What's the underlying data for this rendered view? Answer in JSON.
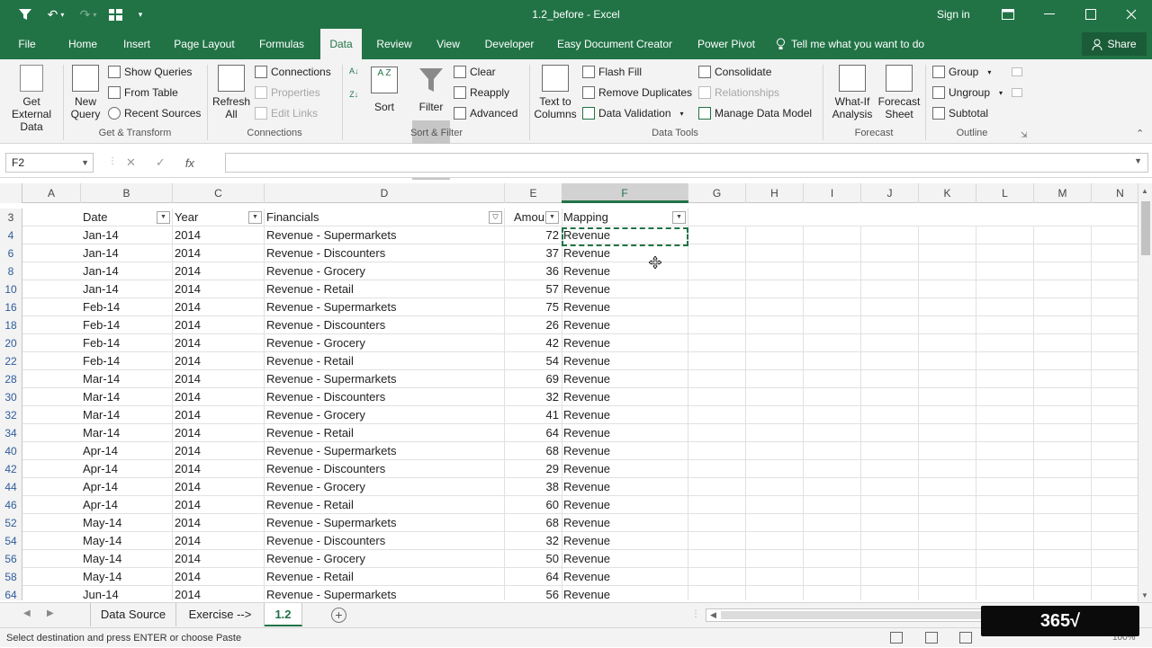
{
  "title_bar": {
    "document_title": "1.2_before  -  Excel",
    "sign_in": "Sign in",
    "accent": "#217346"
  },
  "tabs": [
    "File",
    "Home",
    "Insert",
    "Page Layout",
    "Formulas",
    "Data",
    "Review",
    "View",
    "Developer",
    "Easy Document Creator",
    "Power Pivot"
  ],
  "active_tab": "Data",
  "tell_me": "Tell me what you want to do",
  "share": "Share",
  "ribbon": {
    "get_external_data": [
      "Get External",
      "Data"
    ],
    "new_query": [
      "New",
      "Query"
    ],
    "show_queries": "Show Queries",
    "from_table": "From Table",
    "recent_sources": "Recent Sources",
    "get_transform": "Get & Transform",
    "refresh_all": [
      "Refresh",
      "All"
    ],
    "connections": "Connections",
    "properties": "Properties",
    "edit_links": "Edit Links",
    "connections_group": "Connections",
    "sort": "Sort",
    "filter": "Filter",
    "clear": "Clear",
    "reapply": "Reapply",
    "advanced": "Advanced",
    "sort_filter": "Sort & Filter",
    "text_to_columns": [
      "Text to",
      "Columns"
    ],
    "flash_fill": "Flash Fill",
    "remove_duplicates": "Remove Duplicates",
    "data_validation": "Data Validation",
    "consolidate": "Consolidate",
    "relationships": "Relationships",
    "manage_data_model": "Manage Data Model",
    "data_tools": "Data Tools",
    "what_if": [
      "What-If",
      "Analysis"
    ],
    "forecast_sheet": [
      "Forecast",
      "Sheet"
    ],
    "forecast": "Forecast",
    "group": "Group",
    "ungroup": "Ungroup",
    "subtotal": "Subtotal",
    "outline": "Outline",
    "sort_az": "A Z"
  },
  "formula_bar": {
    "name_box": "F2",
    "cancel": "✕",
    "enter": "✓",
    "fx": "fx",
    "formula": ""
  },
  "columns": [
    "A",
    "B",
    "C",
    "D",
    "E",
    "F",
    "G",
    "H",
    "I",
    "J",
    "K",
    "L",
    "M",
    "N"
  ],
  "header_row": {
    "row_num": "3",
    "date": "Date",
    "year": "Year",
    "financials": "Financials",
    "amount": "Amou",
    "mapping": "Mapping"
  },
  "rows": [
    {
      "num": "4",
      "date": "Jan-14",
      "year": "2014",
      "fin": "Revenue - Supermarkets",
      "amt": "72",
      "map": "Revenue"
    },
    {
      "num": "6",
      "date": "Jan-14",
      "year": "2014",
      "fin": "Revenue - Discounters",
      "amt": "37",
      "map": "Revenue"
    },
    {
      "num": "8",
      "date": "Jan-14",
      "year": "2014",
      "fin": "Revenue - Grocery",
      "amt": "36",
      "map": "Revenue"
    },
    {
      "num": "10",
      "date": "Jan-14",
      "year": "2014",
      "fin": "Revenue - Retail",
      "amt": "57",
      "map": "Revenue"
    },
    {
      "num": "16",
      "date": "Feb-14",
      "year": "2014",
      "fin": "Revenue - Supermarkets",
      "amt": "75",
      "map": "Revenue"
    },
    {
      "num": "18",
      "date": "Feb-14",
      "year": "2014",
      "fin": "Revenue - Discounters",
      "amt": "26",
      "map": "Revenue"
    },
    {
      "num": "20",
      "date": "Feb-14",
      "year": "2014",
      "fin": "Revenue - Grocery",
      "amt": "42",
      "map": "Revenue"
    },
    {
      "num": "22",
      "date": "Feb-14",
      "year": "2014",
      "fin": "Revenue - Retail",
      "amt": "54",
      "map": "Revenue"
    },
    {
      "num": "28",
      "date": "Mar-14",
      "year": "2014",
      "fin": "Revenue - Supermarkets",
      "amt": "69",
      "map": "Revenue"
    },
    {
      "num": "30",
      "date": "Mar-14",
      "year": "2014",
      "fin": "Revenue - Discounters",
      "amt": "32",
      "map": "Revenue"
    },
    {
      "num": "32",
      "date": "Mar-14",
      "year": "2014",
      "fin": "Revenue - Grocery",
      "amt": "41",
      "map": "Revenue"
    },
    {
      "num": "34",
      "date": "Mar-14",
      "year": "2014",
      "fin": "Revenue - Retail",
      "amt": "64",
      "map": "Revenue"
    },
    {
      "num": "40",
      "date": "Apr-14",
      "year": "2014",
      "fin": "Revenue - Supermarkets",
      "amt": "68",
      "map": "Revenue"
    },
    {
      "num": "42",
      "date": "Apr-14",
      "year": "2014",
      "fin": "Revenue - Discounters",
      "amt": "29",
      "map": "Revenue"
    },
    {
      "num": "44",
      "date": "Apr-14",
      "year": "2014",
      "fin": "Revenue - Grocery",
      "amt": "38",
      "map": "Revenue"
    },
    {
      "num": "46",
      "date": "Apr-14",
      "year": "2014",
      "fin": "Revenue - Retail",
      "amt": "60",
      "map": "Revenue"
    },
    {
      "num": "52",
      "date": "May-14",
      "year": "2014",
      "fin": "Revenue - Supermarkets",
      "amt": "68",
      "map": "Revenue"
    },
    {
      "num": "54",
      "date": "May-14",
      "year": "2014",
      "fin": "Revenue - Discounters",
      "amt": "32",
      "map": "Revenue"
    },
    {
      "num": "56",
      "date": "May-14",
      "year": "2014",
      "fin": "Revenue - Grocery",
      "amt": "50",
      "map": "Revenue"
    },
    {
      "num": "58",
      "date": "May-14",
      "year": "2014",
      "fin": "Revenue - Retail",
      "amt": "64",
      "map": "Revenue"
    },
    {
      "num": "64",
      "date": "Jun-14",
      "year": "2014",
      "fin": "Revenue - Supermarkets",
      "amt": "56",
      "map": "Revenue"
    }
  ],
  "sheets": [
    "Data Source",
    "Exercise -->",
    "1.2"
  ],
  "active_sheet": "1.2",
  "status": "Select destination and press ENTER or choose Paste",
  "zoom": "100%",
  "logo": "365√"
}
